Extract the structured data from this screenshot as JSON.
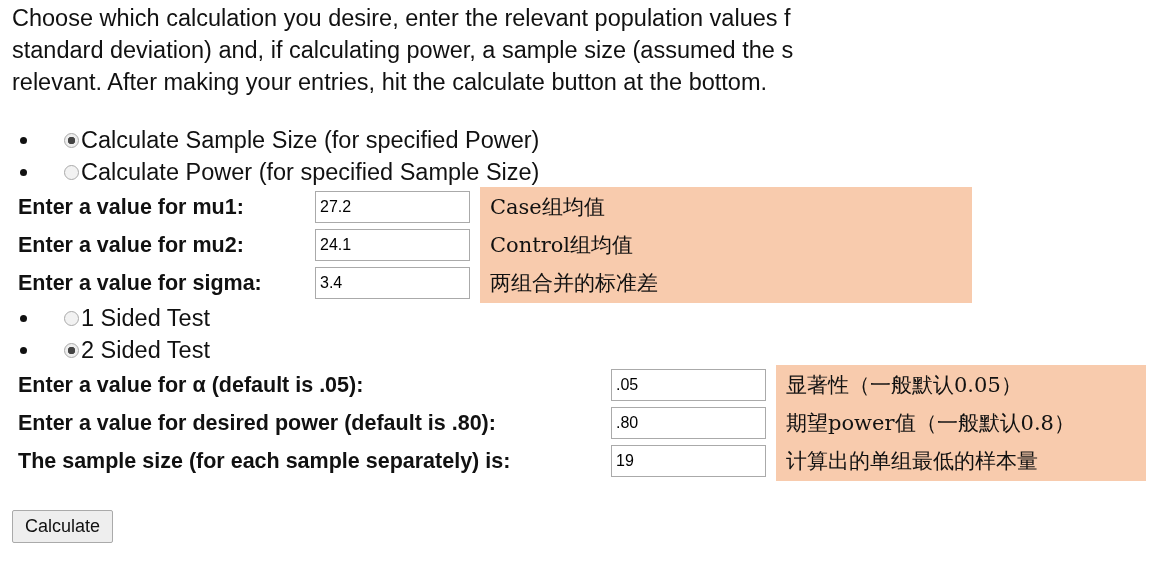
{
  "intro_lines": [
    "Choose which calculation you desire, enter the relevant population values f",
    "standard deviation) and, if calculating power, a sample size (assumed the s",
    "relevant. After making your entries, hit the calculate button at the bottom."
  ],
  "calculation_options": [
    {
      "label": "Calculate Sample Size (for specified Power)",
      "selected": true
    },
    {
      "label": "Calculate Power (for specified Sample Size)",
      "selected": false
    }
  ],
  "population_fields": [
    {
      "label": "Enter a value for mu1:",
      "value": "27.2",
      "note": "Case组均值"
    },
    {
      "label": "Enter a value for mu2:",
      "value": "24.1",
      "note": "Control组均值"
    },
    {
      "label": "Enter a value for sigma:",
      "value": "3.4",
      "note": "两组合并的标准差"
    }
  ],
  "test_options": [
    {
      "label": "1 Sided Test",
      "selected": false
    },
    {
      "label": "2 Sided Test",
      "selected": true
    }
  ],
  "parameter_fields": [
    {
      "label": "Enter a value for α (default is .05):",
      "value": ".05",
      "note": "显著性（一般默认0.05）"
    },
    {
      "label": "Enter a value for desired power (default is .80):",
      "value": ".80",
      "note": "期望power值（一般默认0.8）"
    },
    {
      "label": "The sample size (for each sample separately) is:",
      "value": "19",
      "note": "计算出的单组最低的样本量"
    }
  ],
  "calculate_button": "Calculate"
}
